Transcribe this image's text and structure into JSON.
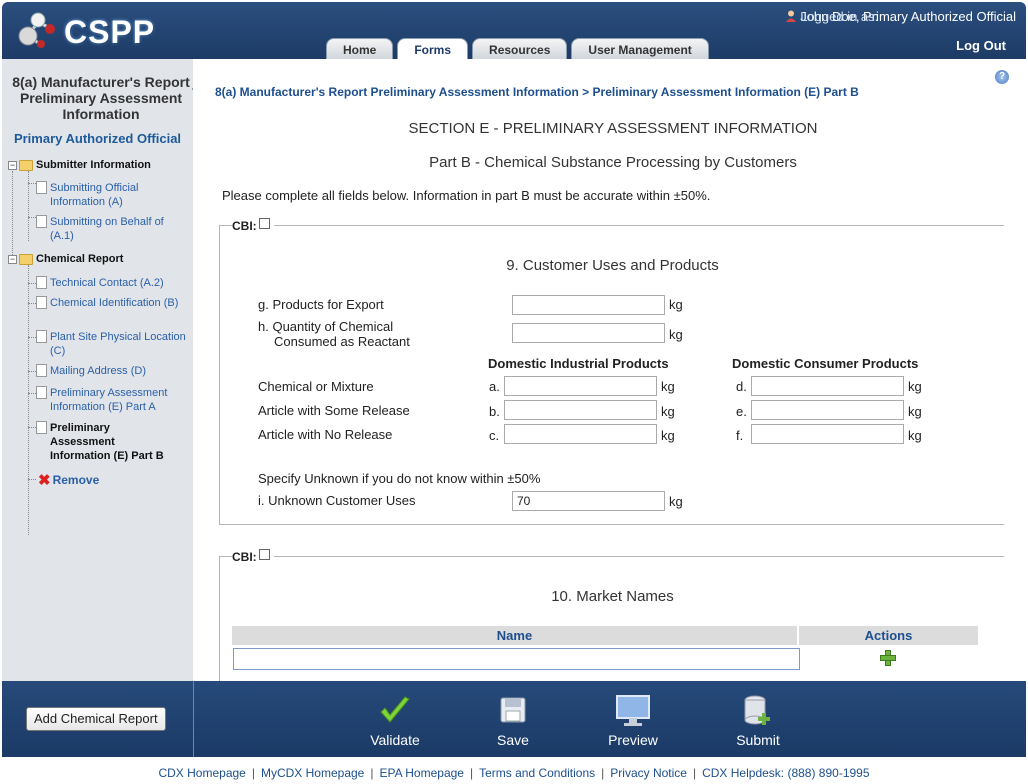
{
  "header": {
    "logo_text": "CSPP",
    "logged_in_label": "Logged in as:",
    "logged_in_user": "John Doe, Primary Authorized Official",
    "logout": "Log Out",
    "tabs": [
      "Home",
      "Forms",
      "Resources",
      "User Management"
    ],
    "active_tab": "Forms"
  },
  "sidebar": {
    "title": "8(a) Manufacturer's Report Preliminary Assessment Information",
    "role": "Primary Authorized Official",
    "groups": [
      {
        "label": "Submitter Information",
        "items": [
          "Submitting Official Information (A)",
          "Submitting on Behalf of (A.1)"
        ]
      },
      {
        "label": "Chemical Report",
        "items": [
          "Technical Contact (A.2)",
          "Chemical Identification (B)",
          "Plant Site Physical Location (C)",
          "Mailing Address (D)",
          "Preliminary Assessment Information (E) Part A",
          "Preliminary Assessment Information (E) Part B"
        ]
      }
    ],
    "remove": "Remove"
  },
  "main": {
    "help": "?",
    "breadcrumb": [
      "8(a) Manufacturer's Report Preliminary Assessment Information",
      "Preliminary Assessment Information (E) Part B"
    ],
    "breadcrumb_sep": " > ",
    "section_title": "SECTION E - PRELIMINARY ASSESSMENT INFORMATION",
    "part_title": "Part B - Chemical Substance Processing by Customers",
    "instructions": "Please complete all fields below. Information in part B must be accurate within ±50%.",
    "cbi_label": "CBI:",
    "q9": {
      "title": "9. Customer Uses and Products",
      "g_label": "g. Products for Export",
      "h_label_1": "h. Quantity of Chemical",
      "h_label_2": "Consumed as Reactant",
      "unit": "kg",
      "col_industrial": "Domestic Industrial Products",
      "col_consumer": "Domestic Consumer Products",
      "rows": [
        {
          "label": "Chemical or Mixture",
          "ind_letter": "a.",
          "con_letter": "d."
        },
        {
          "label": "Article with Some Release",
          "ind_letter": "b.",
          "con_letter": "e."
        },
        {
          "label": "Article with No Release",
          "ind_letter": "c.",
          "con_letter": "f."
        }
      ],
      "unknown_note": "Specify Unknown if you do not know within ±50%",
      "i_label": "i. Unknown Customer Uses",
      "i_value": "70"
    },
    "q10": {
      "title": "10. Market Names",
      "col_name": "Name",
      "col_actions": "Actions"
    }
  },
  "bottom": {
    "add_button": "Add Chemical Report",
    "actions": [
      "Validate",
      "Save",
      "Preview",
      "Submit"
    ]
  },
  "footer": {
    "links": [
      "CDX Homepage",
      "MyCDX Homepage",
      "EPA Homepage",
      "Terms and Conditions",
      "Privacy Notice",
      "CDX Helpdesk: (888) 890-1995"
    ]
  },
  "colors": {
    "header": "#1d3b66",
    "sidebar": "#e1e5ea",
    "link": "#2a5fa8"
  }
}
